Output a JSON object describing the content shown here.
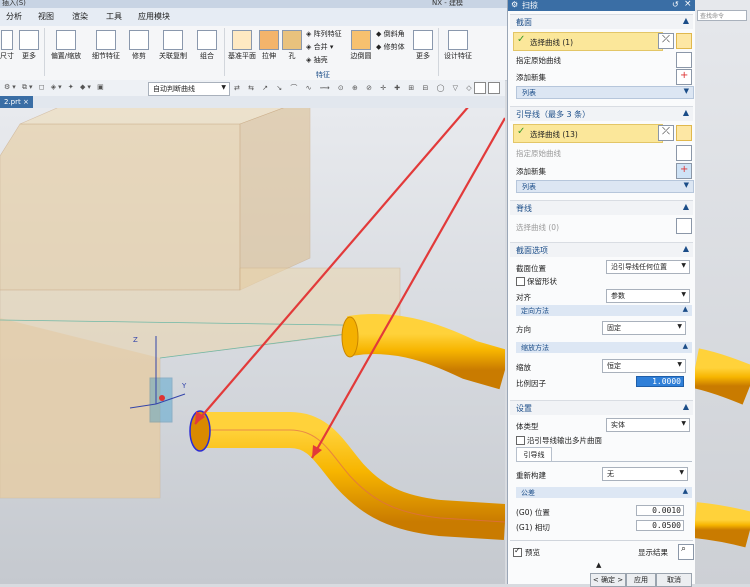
{
  "app": {
    "title": "NX - 建模",
    "menu_fragment": "插入(S)",
    "search_placeholder": "查找命令",
    "file_tab": "2.prt"
  },
  "menubar": [
    "分析",
    "视图",
    "渲染",
    "工具",
    "应用模块"
  ],
  "ribbon": {
    "left_labels": [
      "尺寸",
      "更多"
    ],
    "group_sync": [
      "偏置/缩放",
      "细节特征",
      "修剪",
      "关联复制",
      "组合"
    ],
    "group_feature": [
      "基准平面",
      "拉伸",
      "孔",
      "阵列特征",
      "合并",
      "抽壳",
      "边倒圆",
      "倒斜角",
      "修剪体",
      "更多",
      "设计特征"
    ],
    "feature_group_label": "特征"
  },
  "toolbar2": {
    "filter_value": "自动判断曲线"
  },
  "dialog": {
    "title": "扫掠",
    "section": {
      "header": "截面",
      "select_curve": "选择曲线 (1)",
      "specify_origin": "指定原始曲线",
      "add_new_set": "添加新集",
      "list": "列表"
    },
    "guide": {
      "header": "引导线（最多 3 条）",
      "select_curve": "选择曲线 (13)",
      "specify_origin": "指定原始曲线",
      "add_new_set": "添加新集",
      "list": "列表"
    },
    "spine": {
      "header": "脊线",
      "select_curve": "选择曲线 (0)"
    },
    "section_options": {
      "header": "截面选项",
      "section_position_label": "截面位置",
      "section_position_value": "沿引导线任何位置",
      "preserve_shape": "保留形状",
      "alignment_label": "对齐",
      "alignment_value": "参数",
      "orientation_header": "定向方法",
      "direction_label": "方向",
      "direction_value": "固定",
      "scaling_header": "缩放方法",
      "scaling_label": "缩放",
      "scaling_value": "恒定",
      "scale_factor_label": "比例因子",
      "scale_factor_value": "1.0000"
    },
    "settings": {
      "header": "设置",
      "body_type_label": "体类型",
      "body_type_value": "实体",
      "multi_face": "沿引导线输出多片曲面",
      "guide_tab": "引导线",
      "rebuild_label": "重新构建",
      "rebuild_value": "无",
      "tolerance_header": "公差",
      "g0_label": "(G0) 位置",
      "g0_value": "0.0010",
      "g1_label": "(G1) 相切",
      "g1_value": "0.0500"
    },
    "preview_label": "预览",
    "show_result": "显示结果",
    "ok": "< 确定 >",
    "apply": "应用",
    "cancel": "取消"
  },
  "colors": {
    "accent": "#3a6ea5",
    "pipe": "#f5a800",
    "selection": "#fbe79a",
    "arrow": "#e23a3a"
  }
}
